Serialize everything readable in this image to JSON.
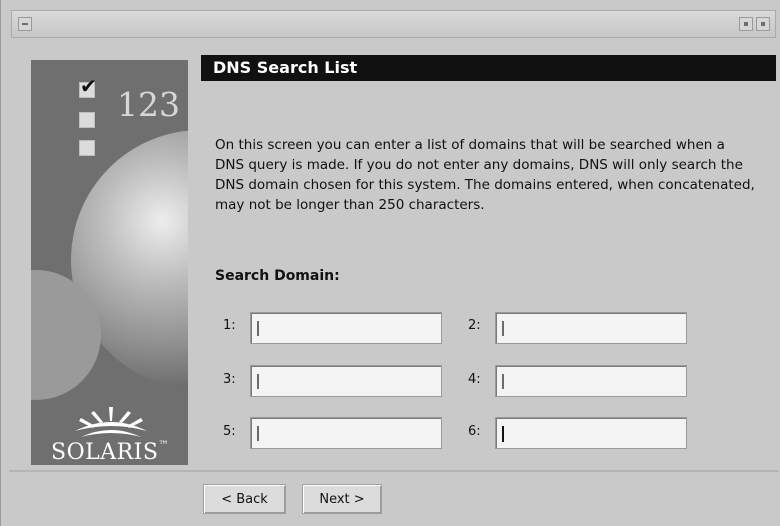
{
  "window": {
    "titlebar": {
      "left_button_icon": "window-menu-icon",
      "right_button_icons": [
        "minimize-icon",
        "maximize-icon"
      ]
    }
  },
  "sidebar": {
    "steps_numeral": "123",
    "checkbox_icons": [
      "checked-box-icon",
      "empty-box-icon",
      "empty-box-icon"
    ],
    "logo_text": "SOLARIS",
    "logo_tm": "™"
  },
  "page": {
    "title": "DNS Search List",
    "description": "On this screen you can enter a list of domains that will be searched when a DNS query is made. If you do not enter any domains, DNS will only search the DNS domain chosen for this system. The domains entered, when concatenated, may not be longer than 250 characters.",
    "section_label": "Search Domain:"
  },
  "domains": [
    {
      "label": "1:",
      "value": ""
    },
    {
      "label": "2:",
      "value": ""
    },
    {
      "label": "3:",
      "value": ""
    },
    {
      "label": "4:",
      "value": ""
    },
    {
      "label": "5:",
      "value": ""
    },
    {
      "label": "6:",
      "value": ""
    }
  ],
  "buttons": {
    "back": "< Back",
    "next": "Next >"
  },
  "colors": {
    "background": "#c9c9c9",
    "header_bg": "#111111",
    "header_text": "#ffffff"
  }
}
